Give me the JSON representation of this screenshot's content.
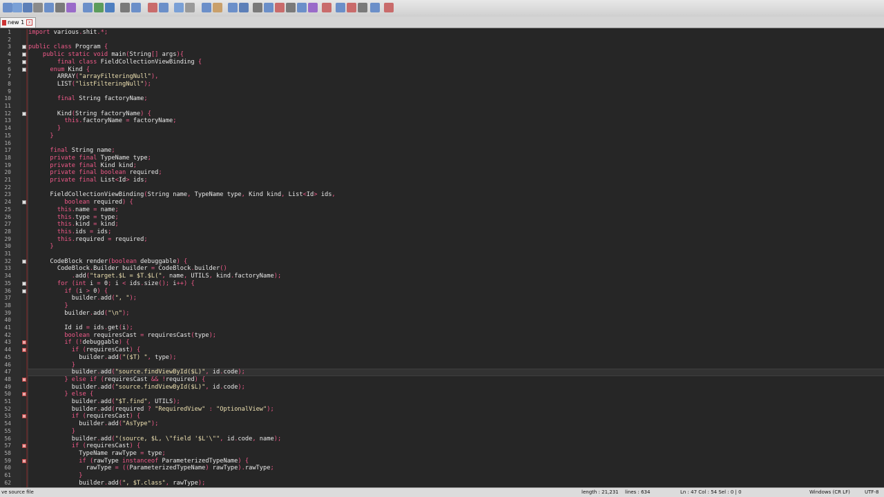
{
  "tab": {
    "label": "new 1"
  },
  "status": {
    "file_type": "ve source file",
    "length": "length : 21,231",
    "lines": "lines : 634",
    "position": "Ln : 47    Col : 54    Sel : 0 | 0",
    "eol": "Windows (CR LF)",
    "encoding": "UTF-8"
  },
  "current_line": 47,
  "lines": [
    {
      "n": "1",
      "t": "import various.shit.*;"
    },
    {
      "n": "2",
      "t": ""
    },
    {
      "n": "3",
      "t": "public class Program {",
      "f": 1
    },
    {
      "n": "4",
      "t": "    public static void main(String[] args){",
      "f": 1
    },
    {
      "n": "5",
      "t": "        final class FieldCollectionViewBinding {",
      "f": 1
    },
    {
      "n": "6",
      "t": "      enum Kind {",
      "f": 1
    },
    {
      "n": "7",
      "t": "        ARRAY(\"arrayFilteringNull\"),"
    },
    {
      "n": "8",
      "t": "        LIST(\"listFilteringNull\");"
    },
    {
      "n": "9",
      "t": ""
    },
    {
      "n": "10",
      "t": "        final String factoryName;"
    },
    {
      "n": "11",
      "t": ""
    },
    {
      "n": "12",
      "t": "        Kind(String factoryName) {",
      "f": 1
    },
    {
      "n": "13",
      "t": "          this.factoryName = factoryName;"
    },
    {
      "n": "14",
      "t": "        }"
    },
    {
      "n": "15",
      "t": "      }"
    },
    {
      "n": "16",
      "t": ""
    },
    {
      "n": "17",
      "t": "      final String name;"
    },
    {
      "n": "18",
      "t": "      private final TypeName type;"
    },
    {
      "n": "19",
      "t": "      private final Kind kind;"
    },
    {
      "n": "20",
      "t": "      private final boolean required;"
    },
    {
      "n": "21",
      "t": "      private final List<Id> ids;"
    },
    {
      "n": "22",
      "t": ""
    },
    {
      "n": "23",
      "t": "      FieldCollectionViewBinding(String name, TypeName type, Kind kind, List<Id> ids,"
    },
    {
      "n": "24",
      "t": "          boolean required) {",
      "f": 1
    },
    {
      "n": "25",
      "t": "        this.name = name;"
    },
    {
      "n": "26",
      "t": "        this.type = type;"
    },
    {
      "n": "27",
      "t": "        this.kind = kind;"
    },
    {
      "n": "28",
      "t": "        this.ids = ids;"
    },
    {
      "n": "29",
      "t": "        this.required = required;"
    },
    {
      "n": "30",
      "t": "      }"
    },
    {
      "n": "31",
      "t": ""
    },
    {
      "n": "32",
      "t": "      CodeBlock render(boolean debuggable) {",
      "f": 1
    },
    {
      "n": "33",
      "t": "        CodeBlock.Builder builder = CodeBlock.builder()"
    },
    {
      "n": "34",
      "t": "            .add(\"target.$L = $T.$L(\", name, UTILS, kind.factoryName);"
    },
    {
      "n": "35",
      "t": "        for (int i = 0; i < ids.size(); i++) {",
      "f": 1
    },
    {
      "n": "36",
      "t": "          if (i > 0) {",
      "f": 1
    },
    {
      "n": "37",
      "t": "            builder.add(\", \");"
    },
    {
      "n": "38",
      "t": "          }"
    },
    {
      "n": "39",
      "t": "          builder.add(\"\\n\");"
    },
    {
      "n": "40",
      "t": ""
    },
    {
      "n": "41",
      "t": "          Id id = ids.get(i);"
    },
    {
      "n": "42",
      "t": "          boolean requiresCast = requiresCast(type);"
    },
    {
      "n": "43",
      "t": "          if (!debuggable) {",
      "f": 2
    },
    {
      "n": "44",
      "t": "            if (requiresCast) {",
      "f": 2
    },
    {
      "n": "45",
      "t": "              builder.add(\"($T) \", type);"
    },
    {
      "n": "46",
      "t": "            }"
    },
    {
      "n": "47",
      "t": "            builder.add(\"source.findViewById($L)\", id.code);"
    },
    {
      "n": "48",
      "t": "          } else if (requiresCast && !required) {",
      "f": 2
    },
    {
      "n": "49",
      "t": "            builder.add(\"source.findViewById($L)\", id.code);"
    },
    {
      "n": "50",
      "t": "          } else {",
      "f": 2
    },
    {
      "n": "51",
      "t": "            builder.add(\"$T.find\", UTILS);"
    },
    {
      "n": "52",
      "t": "            builder.add(required ? \"RequiredView\" : \"OptionalView\");"
    },
    {
      "n": "53",
      "t": "            if (requiresCast) {",
      "f": 2
    },
    {
      "n": "54",
      "t": "              builder.add(\"AsType\");"
    },
    {
      "n": "55",
      "t": "            }"
    },
    {
      "n": "56",
      "t": "            builder.add(\"(source, $L, \\\"field '$L'\\\"\", id.code, name);"
    },
    {
      "n": "57",
      "t": "            if (requiresCast) {",
      "f": 2
    },
    {
      "n": "58",
      "t": "              TypeName rawType = type;"
    },
    {
      "n": "59",
      "t": "              if (rawType instanceof ParameterizedTypeName) {",
      "f": 2
    },
    {
      "n": "60",
      "t": "                rawType = ((ParameterizedTypeName) rawType).rawType;"
    },
    {
      "n": "61",
      "t": "              }"
    },
    {
      "n": "62",
      "t": "              builder.add(\", $T.class\", rawType);"
    }
  ]
}
